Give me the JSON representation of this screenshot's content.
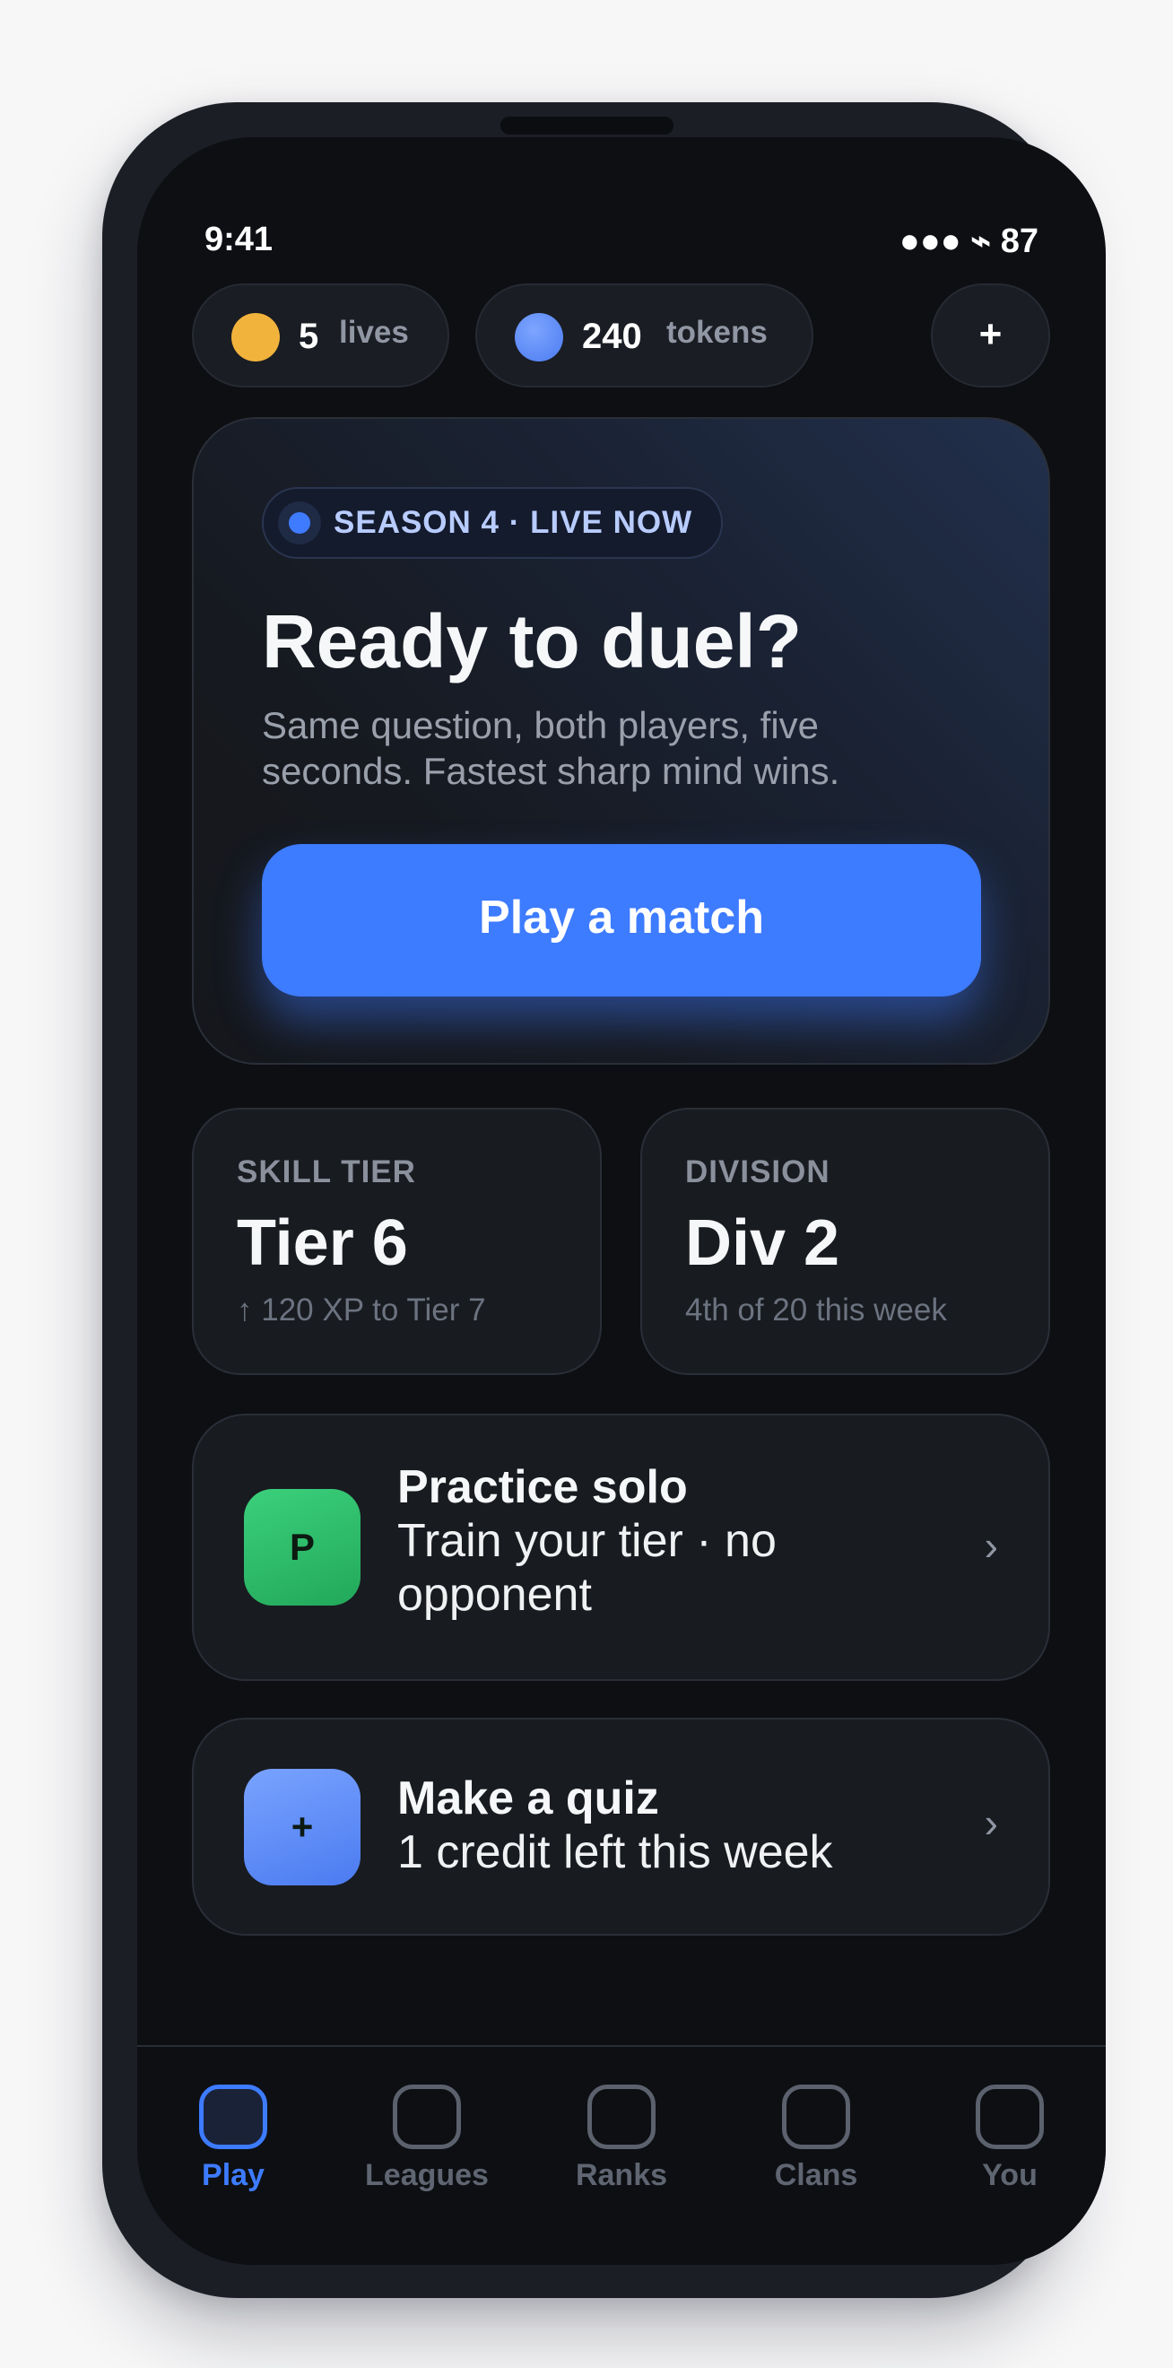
{
  "status": {
    "time": "9:41",
    "indicators": "●●● ⌁ 87"
  },
  "currency": {
    "lives": {
      "value": "5",
      "unit": "lives",
      "color": "#f2b33d"
    },
    "tokens": {
      "value": "240",
      "unit": "tokens",
      "color": "#5b8cff"
    },
    "add_label": "+"
  },
  "hero": {
    "badge": "SEASON 4 · LIVE NOW",
    "title": "Ready to duel?",
    "subtitle": "Same question, both players, five seconds. Fastest sharp mind wins.",
    "cta": "Play a match"
  },
  "stats": {
    "skill": {
      "label": "SKILL TIER",
      "value": "Tier 6",
      "sub": "↑ 120 XP to Tier 7"
    },
    "division": {
      "label": "DIVISION",
      "value": "Div 2",
      "sub": "4th of 20 this week"
    }
  },
  "actions": {
    "practice": {
      "icon_letter": "P",
      "title": "Practice solo",
      "subtitle": "Train your tier · no opponent",
      "chevron": "›"
    },
    "quiz": {
      "icon_letter": "+",
      "title": "Make a quiz",
      "subtitle": "1 credit left this week",
      "chevron": "›"
    }
  },
  "tabs": [
    {
      "label": "Play",
      "active": true
    },
    {
      "label": "Leagues",
      "active": false
    },
    {
      "label": "Ranks",
      "active": false
    },
    {
      "label": "Clans",
      "active": false
    },
    {
      "label": "You",
      "active": false
    }
  ],
  "colors": {
    "accent": "#3d7bff",
    "practice_icon": "#2fbf6c",
    "quiz_icon": "#5b8cff"
  }
}
